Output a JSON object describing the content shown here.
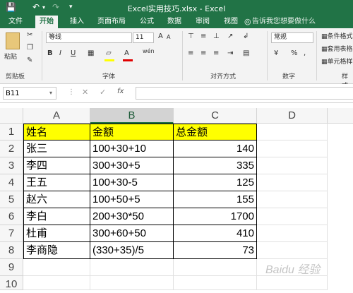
{
  "titlebar": {
    "title": "Excel实用技巧.xlsx - Excel"
  },
  "tabs": [
    "文件",
    "开始",
    "插入",
    "页面布局",
    "公式",
    "数据",
    "审阅",
    "视图"
  ],
  "active_tab_index": 1,
  "tell_me": "告诉我您想要做什么",
  "ribbon": {
    "clipboard": {
      "label": "剪贴板",
      "paste": "粘贴"
    },
    "font": {
      "label": "字体",
      "font_name": "等线",
      "font_size": "11",
      "bold": "B",
      "italic": "I",
      "underline": "U",
      "grow": "A",
      "shrink": "A",
      "wen": "wén"
    },
    "alignment": {
      "label": "对齐方式"
    },
    "number": {
      "label": "数字",
      "format": "常规",
      "percent": "%",
      "comma": ","
    },
    "styles": {
      "label": "样式",
      "conditional": "条件格式",
      "table": "套用表格",
      "cell": "单元格样式"
    }
  },
  "formula_bar": {
    "name_box": "B11",
    "fx": "fx",
    "content": ""
  },
  "columns": [
    "A",
    "B",
    "C",
    "D"
  ],
  "rows": [
    "1",
    "2",
    "3",
    "4",
    "5",
    "6",
    "7",
    "8",
    "9",
    "10"
  ],
  "table": [
    [
      "姓名",
      "金额",
      "总金额"
    ],
    [
      "张三",
      "100+30+10",
      "140"
    ],
    [
      "李四",
      "300+30+5",
      "335"
    ],
    [
      "王五",
      "100+30-5",
      "125"
    ],
    [
      "赵六",
      "100+50+5",
      "155"
    ],
    [
      "李白",
      "200+30*50",
      "1700"
    ],
    [
      "杜甫",
      "300+60+50",
      "410"
    ],
    [
      "李商隐",
      "(330+35)/5",
      "73"
    ]
  ],
  "watermark": "Baidu 经验",
  "colors": {
    "excel_green": "#217346",
    "header_fill": "#ffff00"
  }
}
